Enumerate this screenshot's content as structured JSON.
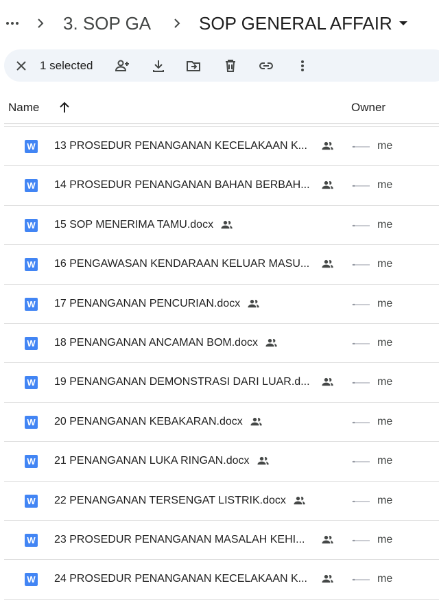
{
  "breadcrumb": {
    "more_icon": "more-horiz-icon",
    "items": [
      "3. SOP GA",
      "SOP GENERAL AFFAIR"
    ]
  },
  "toolbar": {
    "selected_text": "1 selected",
    "icons": [
      "close-icon",
      "share-person-add-icon",
      "download-icon",
      "move-to-folder-icon",
      "trash-icon",
      "link-icon",
      "more-vert-icon"
    ]
  },
  "header": {
    "name": "Name",
    "owner": "Owner"
  },
  "rows": [
    {
      "name": "13 PROSEDUR PENANGANAN KECELAKAAN K...",
      "owner": "me",
      "truncated": true
    },
    {
      "name": "14 PROSEDUR PENANGANAN BAHAN BERBAH...",
      "owner": "me",
      "truncated": true
    },
    {
      "name": "15 SOP MENERIMA TAMU.docx",
      "owner": "me",
      "truncated": false
    },
    {
      "name": "16 PENGAWASAN KENDARAAN KELUAR MASU...",
      "owner": "me",
      "truncated": true
    },
    {
      "name": "17 PENANGANAN PENCURIAN.docx",
      "owner": "me",
      "truncated": false
    },
    {
      "name": "18 PENANGANAN ANCAMAN BOM.docx",
      "owner": "me",
      "truncated": false
    },
    {
      "name": "19 PENANGANAN DEMONSTRASI DARI LUAR.d...",
      "owner": "me",
      "truncated": true
    },
    {
      "name": "20 PENANGANAN KEBAKARAN.docx",
      "owner": "me",
      "truncated": false
    },
    {
      "name": "21 PENANGANAN LUKA RINGAN.docx",
      "owner": "me",
      "truncated": false
    },
    {
      "name": "22 PENANGANAN TERSENGAT LISTRIK.docx",
      "owner": "me",
      "truncated": false
    },
    {
      "name": "23 PROSEDUR PENANGANAN MASALAH KEHI...",
      "owner": "me",
      "truncated": true
    },
    {
      "name": "24 PROSEDUR PENANGANAN KECELAKAAN K...",
      "owner": "me",
      "truncated": true
    }
  ],
  "doc_icon_letter": "W",
  "colors": {
    "doc_icon": "#4285f4",
    "toolbar_bg": "#f0f4f9",
    "text": "#1f1f1f",
    "secondary_text": "#444746"
  }
}
